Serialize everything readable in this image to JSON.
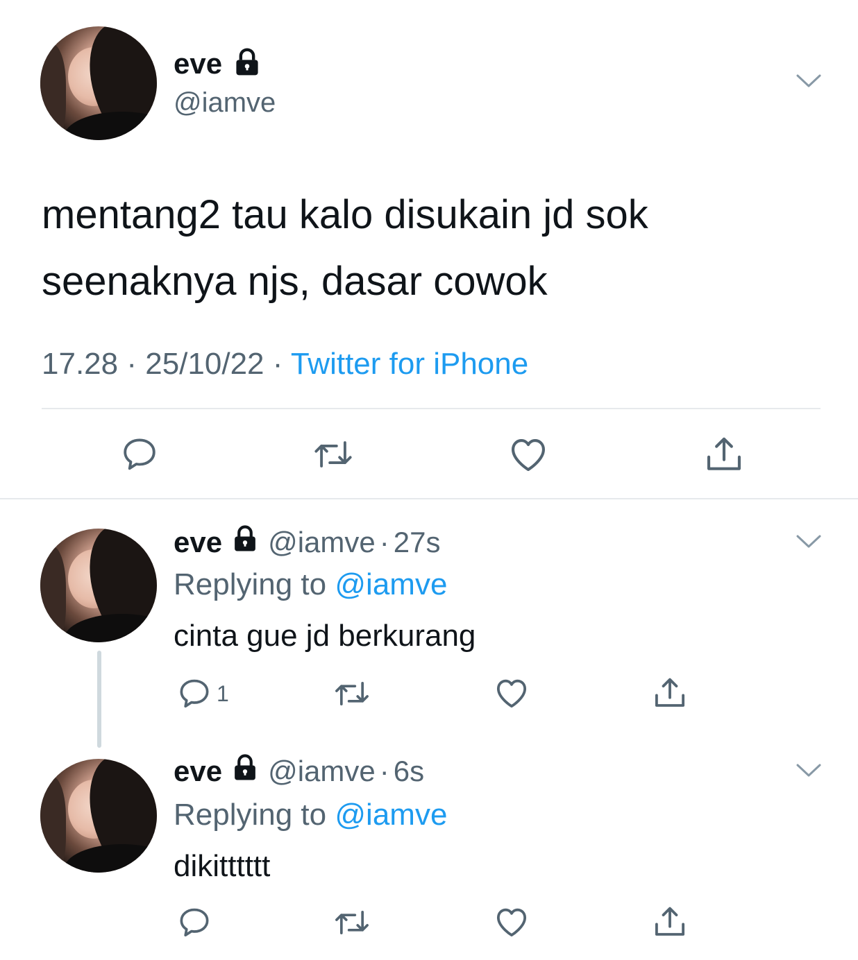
{
  "main_tweet": {
    "name": "eve",
    "handle": "@iamve",
    "text_line1": "mentang2 tau kalo disukain jd sok",
    "text_line2": "seenaknya njs, dasar cowok",
    "time": "17.28",
    "sep1": "·",
    "date": "25/10/22",
    "sep2": "·",
    "source": "Twitter for iPhone"
  },
  "replies": [
    {
      "name": "eve",
      "handle": "@iamve",
      "dot": "·",
      "age": "27s",
      "replying_prefix": "Replying to",
      "replying_handle": "@iamve",
      "text": "cinta gue jd berkurang",
      "reply_count": "1"
    },
    {
      "name": "eve",
      "handle": "@iamve",
      "dot": "·",
      "age": "6s",
      "replying_prefix": "Replying to",
      "replying_handle": "@iamve",
      "text": "dikitttttt"
    }
  ],
  "icons": {
    "reply": "speech-bubble-icon",
    "retweet": "retweet-icon",
    "like": "heart-icon",
    "share": "share-icon",
    "menu": "chevron-down-icon",
    "protected": "lock-icon"
  },
  "colors": {
    "text": "#0f1419",
    "secondary": "#536471",
    "link": "#1d9bf0",
    "icon": "#536471",
    "divider": "#e6e9ec",
    "thread_line": "#cfd9de"
  }
}
